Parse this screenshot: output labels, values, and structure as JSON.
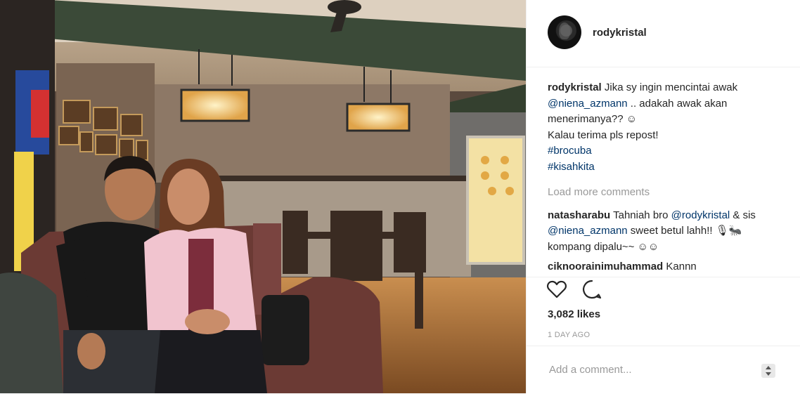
{
  "header": {
    "username": "rodykristal"
  },
  "caption": {
    "username": "rodykristal",
    "text1": "Jika sy ingin mencintai awak",
    "mention": "@niena_azmann",
    "text2": " .. adakah awak akan menerimanya?? ☺",
    "text3": "Kalau terima pls repost!",
    "tag1": "#brocuba",
    "tag2": "#kisahkita"
  },
  "load_more": "Load more comments",
  "comments": [
    {
      "username": "natasharabu",
      "text1": "Tahniah bro ",
      "mention1": "@rodykristal",
      "text2": " & sis ",
      "mention2": "@niena_azmann",
      "text3": " sweet betul lahh!! 🎙🐜 kompang dipalu~~ ☺☺"
    },
    {
      "username": "ciknoorainimuhammad",
      "text": "Kannn"
    }
  ],
  "icons": {
    "like": "heart-icon",
    "comment": "comment-bubble-icon",
    "options": "options-arrows-icon"
  },
  "likes": "3,082 likes",
  "timestamp": "1 DAY AGO",
  "add_comment": {
    "placeholder": "Add a comment..."
  },
  "colors": {
    "link": "#003569",
    "muted": "#999999",
    "border": "#efefef"
  }
}
